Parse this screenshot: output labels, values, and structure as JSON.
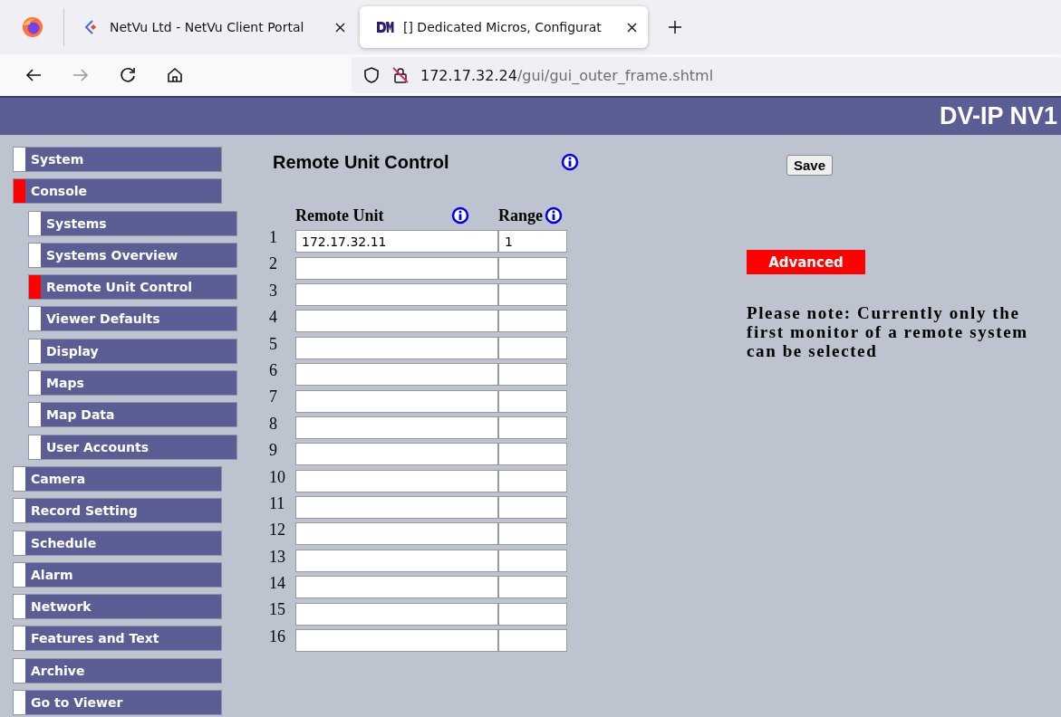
{
  "browser": {
    "tabs": [
      {
        "title": "NetVu Ltd - NetVu Client Portal",
        "selected": false
      },
      {
        "title": "[] Dedicated Micros, Configurat",
        "selected": true
      }
    ],
    "url": {
      "host": "172.17.32.24",
      "path": "/gui/gui_outer_frame.shtml"
    }
  },
  "header": {
    "title": "DV-IP NV1"
  },
  "sidebar": {
    "items": [
      {
        "label": "System",
        "selected": false
      },
      {
        "label": "Console",
        "selected": true,
        "children": [
          {
            "label": "Systems",
            "selected": false
          },
          {
            "label": "Systems Overview",
            "selected": false
          },
          {
            "label": "Remote Unit Control",
            "selected": true
          },
          {
            "label": "Viewer Defaults",
            "selected": false
          },
          {
            "label": "Display",
            "selected": false
          },
          {
            "label": "Maps",
            "selected": false
          },
          {
            "label": "Map Data",
            "selected": false
          },
          {
            "label": "User Accounts",
            "selected": false
          }
        ]
      },
      {
        "label": "Camera",
        "selected": false
      },
      {
        "label": "Record Setting",
        "selected": false
      },
      {
        "label": "Schedule",
        "selected": false
      },
      {
        "label": "Alarm",
        "selected": false
      },
      {
        "label": "Network",
        "selected": false
      },
      {
        "label": "Features and Text",
        "selected": false
      },
      {
        "label": "Archive",
        "selected": false
      },
      {
        "label": "Go to Viewer",
        "selected": false
      }
    ]
  },
  "page": {
    "title": "Remote Unit Control",
    "table": {
      "columns": [
        "Remote Unit",
        "Range"
      ],
      "rows": [
        {
          "number": "1",
          "remote_unit": "172.17.32.11",
          "range": "1"
        },
        {
          "number": "2"
        },
        {
          "number": "3"
        },
        {
          "number": "4"
        },
        {
          "number": "5"
        },
        {
          "number": "6"
        },
        {
          "number": "7"
        },
        {
          "number": "8"
        },
        {
          "number": "9"
        },
        {
          "number": "10"
        },
        {
          "number": "11"
        },
        {
          "number": "12"
        },
        {
          "number": "13"
        },
        {
          "number": "14"
        },
        {
          "number": "15"
        },
        {
          "number": "16"
        }
      ]
    },
    "save_button": "Save",
    "advanced_button": "Advanced",
    "note": "Please note: Currently only the first monitor of a remote system can be selected"
  }
}
